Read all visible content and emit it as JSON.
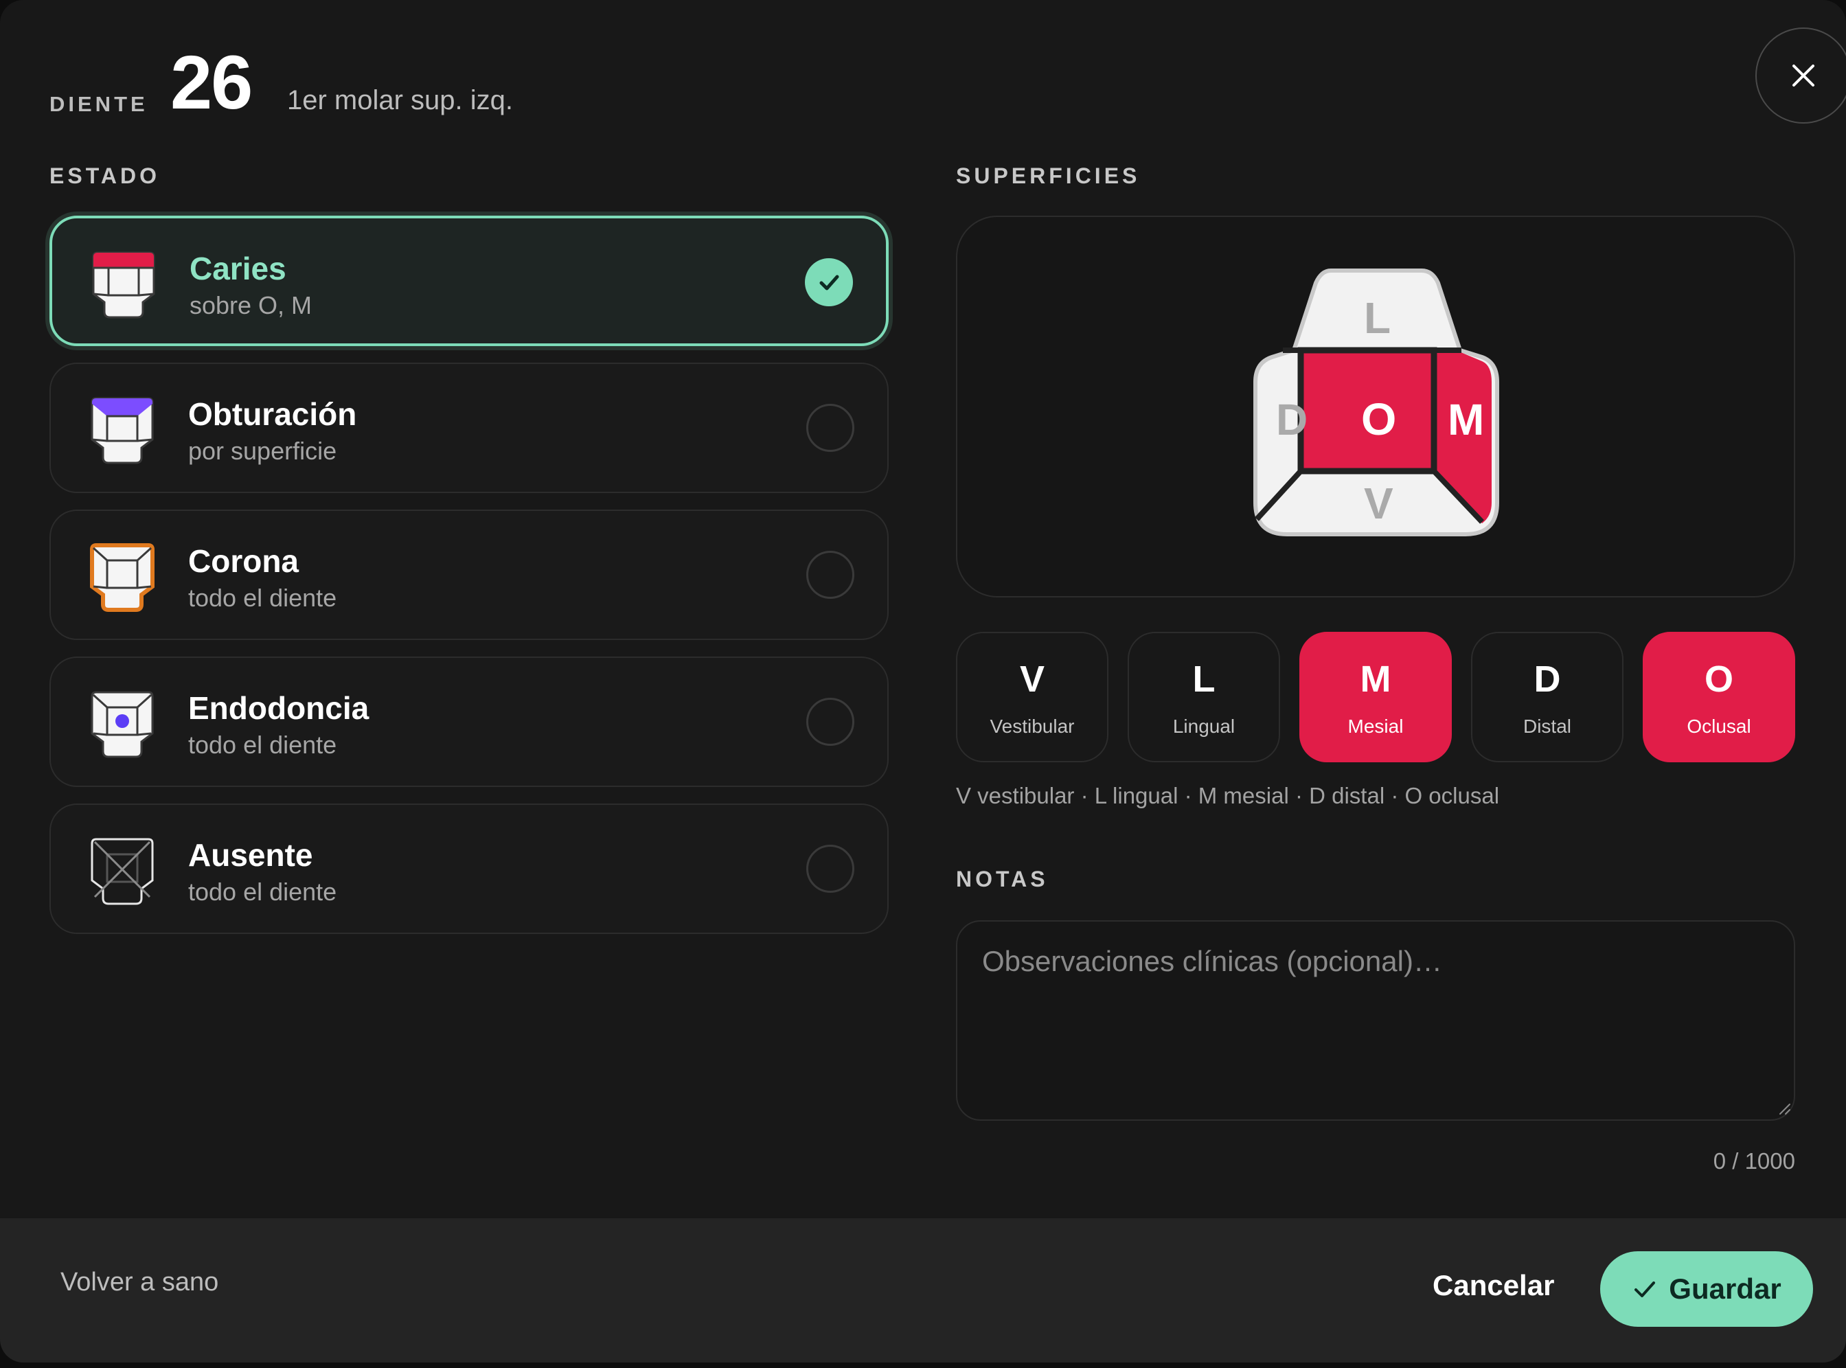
{
  "header": {
    "label": "DIENTE",
    "number": "26",
    "description": "1er molar sup. izq."
  },
  "estado": {
    "label": "ESTADO",
    "options": [
      {
        "title": "Caries",
        "subtitle": "sobre O, M",
        "selected": true,
        "color": "#e11d48"
      },
      {
        "title": "Obturación",
        "subtitle": "por superficie",
        "selected": false,
        "color": "#7c4dff"
      },
      {
        "title": "Corona",
        "subtitle": "todo el diente",
        "selected": false,
        "color": "#e07a1f"
      },
      {
        "title": "Endodoncia",
        "subtitle": "todo el diente",
        "selected": false,
        "color": "#5b3df5"
      },
      {
        "title": "Ausente",
        "subtitle": "todo el diente",
        "selected": false,
        "color": "#6b6b6b"
      }
    ]
  },
  "superficies": {
    "label": "SUPERFICIES",
    "diagram": {
      "L": "L",
      "D": "D",
      "O": "O",
      "M": "M",
      "V": "V"
    },
    "buttons": [
      {
        "letter": "V",
        "name": "Vestibular",
        "active": false
      },
      {
        "letter": "L",
        "name": "Lingual",
        "active": false
      },
      {
        "letter": "M",
        "name": "Mesial",
        "active": true
      },
      {
        "letter": "D",
        "name": "Distal",
        "active": false
      },
      {
        "letter": "O",
        "name": "Oclusal",
        "active": true
      }
    ],
    "legend": "V vestibular · L lingual · M mesial · D distal · O oclusal"
  },
  "notas": {
    "label": "NOTAS",
    "placeholder": "Observaciones clínicas (opcional)…",
    "value": "",
    "counter": "0 / 1000"
  },
  "footer": {
    "reset": "Volver a sano",
    "cancel": "Cancelar",
    "save": "Guardar"
  },
  "colors": {
    "accent": "#7ddcb8",
    "caries": "#e11d48",
    "background": "#181818"
  }
}
